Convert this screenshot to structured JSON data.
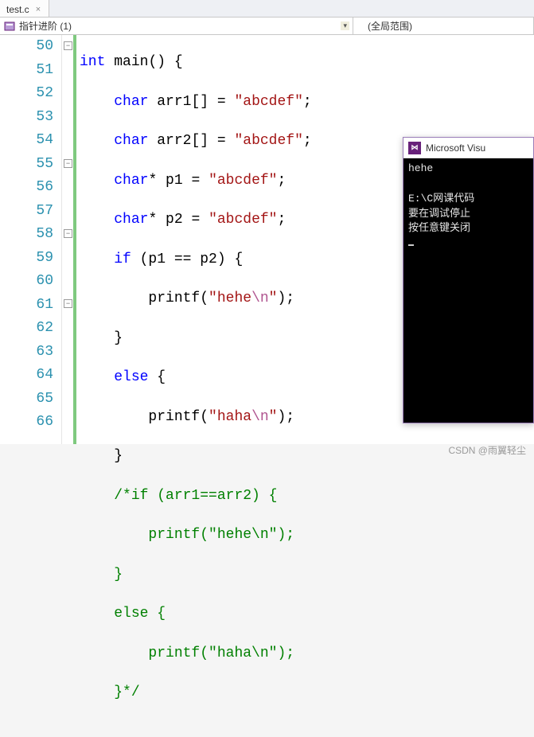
{
  "tab": {
    "filename": "test.c",
    "close": "×"
  },
  "nav": {
    "left_label": "指针进阶 (1)",
    "right_label": "(全局范围)",
    "dropdown_glyph": "▾"
  },
  "line_numbers": [
    50,
    51,
    52,
    53,
    54,
    55,
    56,
    57,
    58,
    59,
    60,
    61,
    62,
    63,
    64,
    65,
    66
  ],
  "fold_glyph": "−",
  "code": {
    "l50": {
      "kw": "int",
      "fn": "main",
      "rest": "() {"
    },
    "l51": {
      "ty": "char",
      "id": "arr1[]",
      "eq": " = ",
      "str": "\"abcdef\"",
      "end": ";"
    },
    "l52": {
      "ty": "char",
      "id": "arr2[]",
      "eq": " = ",
      "str": "\"abcdef\"",
      "end": ";"
    },
    "l53": {
      "ty": "char",
      "id": "* p1",
      "eq": " = ",
      "str": "\"abcdef\"",
      "end": ";"
    },
    "l54": {
      "ty": "char",
      "id": "* p2",
      "eq": " = ",
      "str": "\"abcdef\"",
      "end": ";"
    },
    "l55": {
      "kw": "if",
      "cond": " (p1 == p2) {"
    },
    "l56": {
      "fn": "printf",
      "open": "(",
      "s1": "\"hehe",
      "esc": "\\n",
      "s2": "\"",
      "close": ");"
    },
    "l57": {
      "text": "}"
    },
    "l58": {
      "kw": "else",
      "rest": " {"
    },
    "l59": {
      "fn": "printf",
      "open": "(",
      "s1": "\"haha",
      "esc": "\\n",
      "s2": "\"",
      "close": ");"
    },
    "l60": {
      "text": "}"
    },
    "l61": {
      "cm": "/*if (arr1==arr2) {"
    },
    "l62": {
      "cm": "    printf(\"hehe\\n\");"
    },
    "l63": {
      "cm": "}"
    },
    "l64": {
      "cm": "else {"
    },
    "l65": {
      "cm": "    printf(\"haha\\n\");"
    },
    "l66": {
      "cm": "}*/"
    }
  },
  "console": {
    "title": "Microsoft Visu",
    "out1": "hehe",
    "out2": "",
    "out3": "E:\\C网课代码",
    "out4": "要在调试停止",
    "out5": "按任意键关闭"
  },
  "watermark": "CSDN @雨翼轻尘"
}
